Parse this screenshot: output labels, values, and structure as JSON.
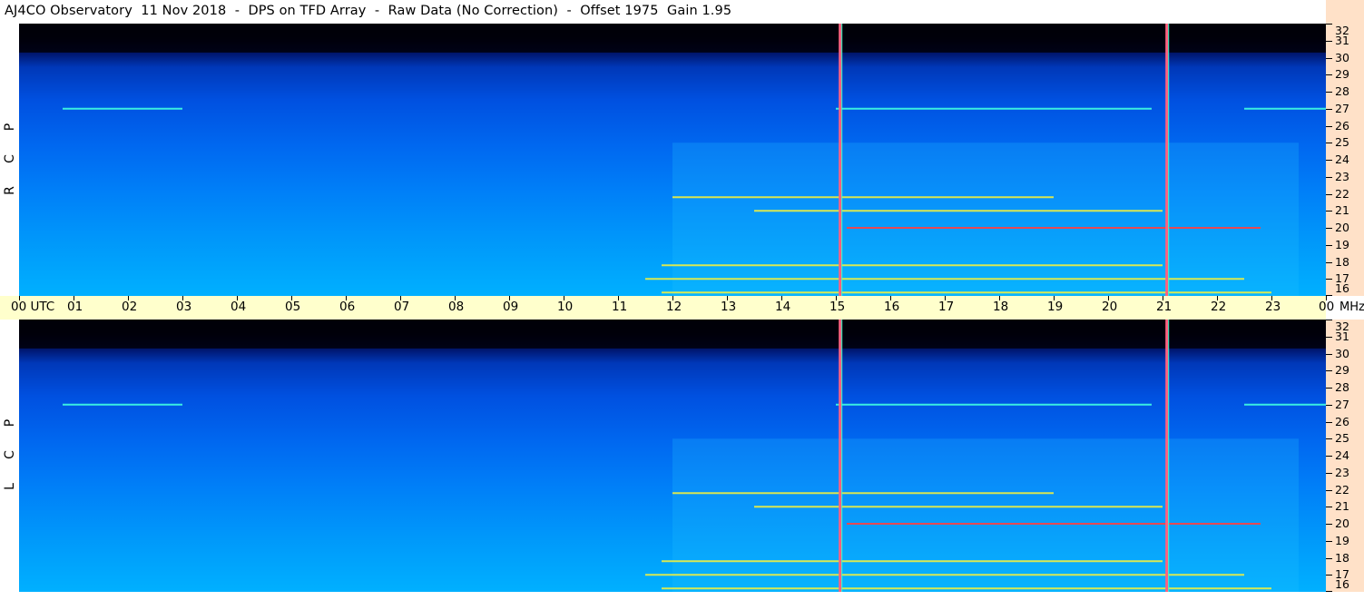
{
  "title": "AJ4CO Observatory  11 Nov 2018  -  DPS on TFD Array  -  Raw Data (No Correction)  -  Offset 1975  Gain 1.95",
  "panels": {
    "top_label": [
      "R",
      "C",
      "P"
    ],
    "bottom_label": [
      "L",
      "C",
      "P"
    ]
  },
  "time_axis": {
    "ticks": [
      "00 UTC",
      "01",
      "02",
      "03",
      "04",
      "05",
      "06",
      "07",
      "08",
      "09",
      "10",
      "11",
      "12",
      "13",
      "14",
      "15",
      "16",
      "17",
      "18",
      "19",
      "20",
      "21",
      "22",
      "23",
      "00"
    ],
    "unit": "MHz"
  },
  "freq_axis": {
    "ticks": [
      "32",
      "31",
      "30",
      "29",
      "28",
      "27",
      "26",
      "25",
      "24",
      "23",
      "22",
      "21",
      "20",
      "19",
      "18",
      "17",
      "16"
    ]
  },
  "colors": {
    "low": "#000008",
    "mid": "#0068f0",
    "high": "#00b0ff",
    "burst_yellow": "#f0f040",
    "burst_cyan": "#40ffe0",
    "burst_red": "#ff4040",
    "axis_bg": "#ffffcc",
    "freq_bg": "#ffe1c8"
  },
  "chart_data": {
    "type": "heatmap",
    "title": "AJ4CO Observatory  11 Nov 2018  -  DPS on TFD Array  -  Raw Data (No Correction)  -  Offset 1975  Gain 1.95",
    "x_range_utc_hours": [
      0,
      24
    ],
    "y_range_mhz": [
      16,
      32
    ],
    "panels": [
      "RCP",
      "LCP"
    ],
    "vertical_interference_lines_utc": [
      15.07,
      21.07
    ],
    "emission_bands": [
      {
        "utc_start": 15.0,
        "utc_end": 20.8,
        "mhz": 27.0,
        "color": "cyan"
      },
      {
        "utc_start": 12.0,
        "utc_end": 19.0,
        "mhz": 21.8,
        "color": "yellow"
      },
      {
        "utc_start": 13.5,
        "utc_end": 21.0,
        "mhz": 21.0,
        "color": "yellow"
      },
      {
        "utc_start": 15.2,
        "utc_end": 22.8,
        "mhz": 20.0,
        "color": "red"
      },
      {
        "utc_start": 11.8,
        "utc_end": 21.0,
        "mhz": 17.8,
        "color": "yellow"
      },
      {
        "utc_start": 11.5,
        "utc_end": 22.5,
        "mhz": 17.0,
        "color": "yellow"
      },
      {
        "utc_start": 11.8,
        "utc_end": 23.0,
        "mhz": 16.2,
        "color": "yellow"
      },
      {
        "utc_start": 0.8,
        "utc_end": 3.0,
        "mhz": 27.0,
        "color": "cyan"
      },
      {
        "utc_start": 22.5,
        "utc_end": 24.0,
        "mhz": 27.0,
        "color": "cyan"
      }
    ]
  }
}
